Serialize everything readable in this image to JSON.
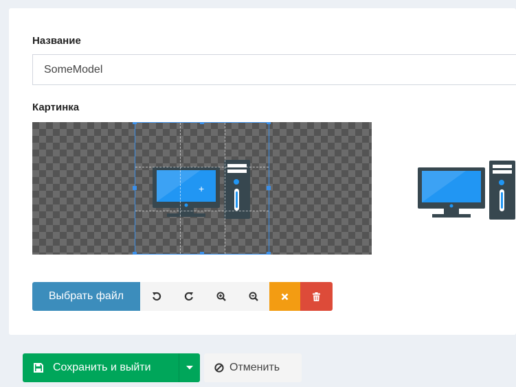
{
  "form": {
    "name_label": "Название",
    "name_value": "SomeModel",
    "picture_label": "Картинка"
  },
  "cropper": {
    "center_mark": "+",
    "image_icon": "desktop-computer-icon",
    "preview_icon": "desktop-computer-icon"
  },
  "toolbar": {
    "choose_file_label": "Выбрать файл",
    "icons": [
      "rotate-left-icon",
      "rotate-right-icon",
      "zoom-in-icon",
      "zoom-out-icon",
      "cancel-icon",
      "trash-icon"
    ]
  },
  "footer": {
    "save_label": "Сохранить и выйти",
    "cancel_label": "Отменить"
  },
  "colors": {
    "primary": "#3c8dbc",
    "success": "#00a65a",
    "warning": "#f39c12",
    "danger": "#dd4b39",
    "crop_box": "#3b8fe8",
    "monitor_screen": "#2196f3",
    "computer_body": "#37474f"
  }
}
